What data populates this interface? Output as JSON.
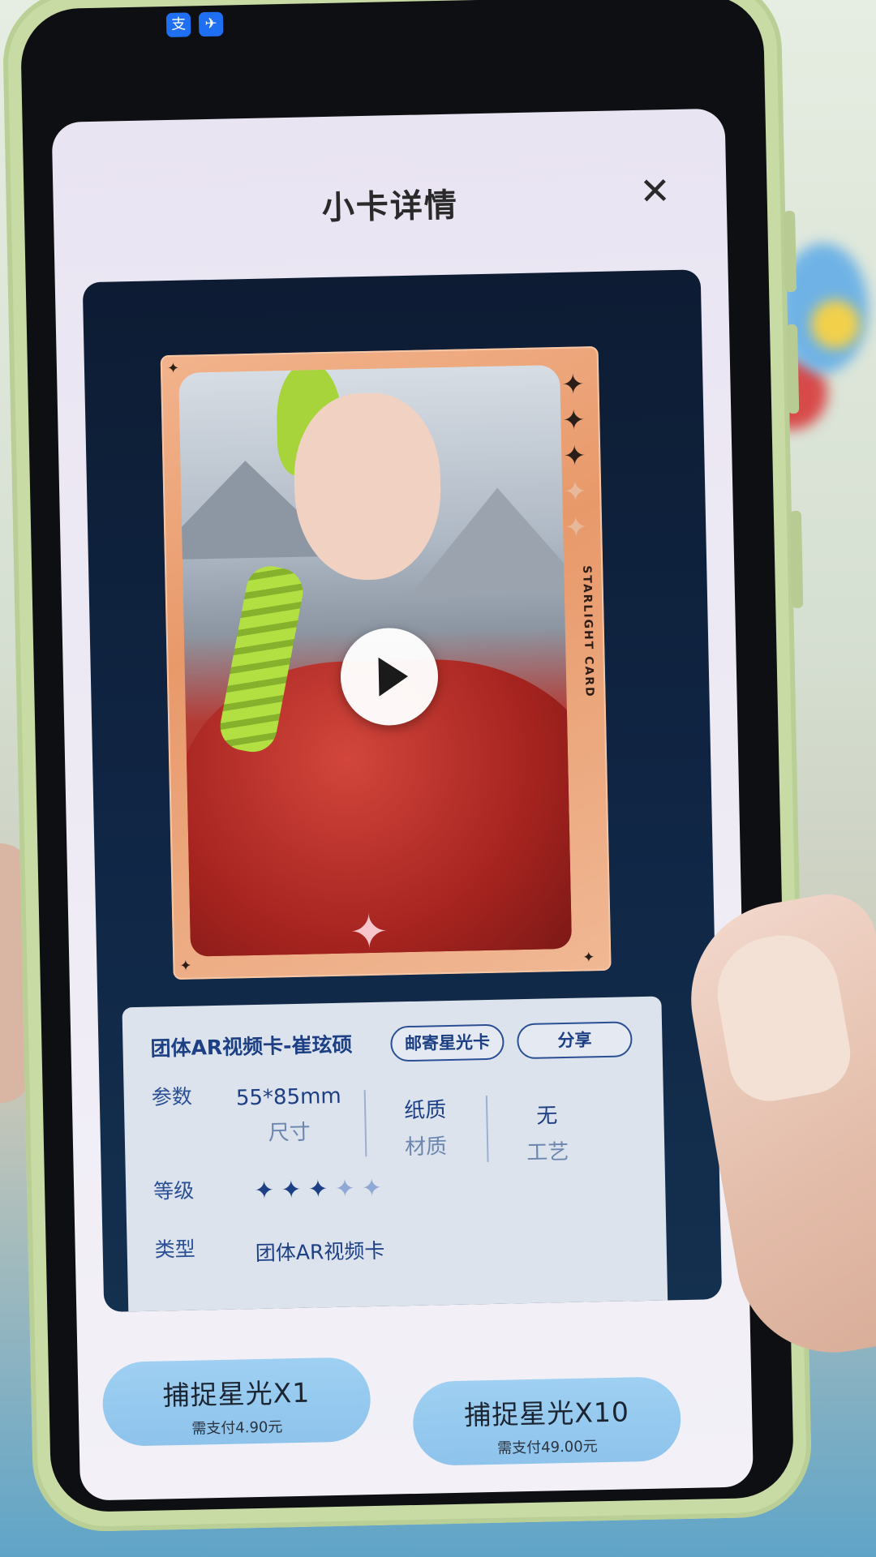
{
  "status_bar": {
    "icons": [
      "alipay-icon",
      "map-icon"
    ],
    "alipay_glyph": "支",
    "map_glyph": "✈"
  },
  "modal": {
    "title": "小卡详情",
    "close_glyph": "✕"
  },
  "card": {
    "vertical_text": "STARLIGHT CARD",
    "diamond_glyph": "✦",
    "diamond_colors": [
      "#2b1e18",
      "#2b1e18",
      "#2b1e18",
      "#e8b89b",
      "#e8b89b"
    ],
    "corner_glyph": "✦",
    "bottom_glyph": "✦"
  },
  "info": {
    "card_name": "团体AR视频卡-崔玹硕",
    "mail_button": "邮寄星光卡",
    "share_button": "分享",
    "params_label": "参数",
    "specs": [
      {
        "value": "55*85mm",
        "key": "尺寸"
      },
      {
        "value": "纸质",
        "key": "材质"
      },
      {
        "value": "无",
        "key": "工艺"
      }
    ],
    "level_label": "等级",
    "level": {
      "filled": 3,
      "total": 5
    },
    "star_glyph": "✦",
    "star_colors": {
      "filled": "#1d3f84",
      "empty": "#8fa8d4"
    },
    "type_label": "类型",
    "type_value": "团体AR视频卡"
  },
  "actions": [
    {
      "label": "捕捉星光X1",
      "price": "需支付4.90元"
    },
    {
      "label": "捕捉星光X10",
      "price": "需支付49.00元"
    }
  ],
  "colors": {
    "accent_blue": "#1d3f84",
    "button_blue": "#9fd0f2",
    "card_orange": "#e8996a",
    "phone_case": "#c8dba5"
  }
}
